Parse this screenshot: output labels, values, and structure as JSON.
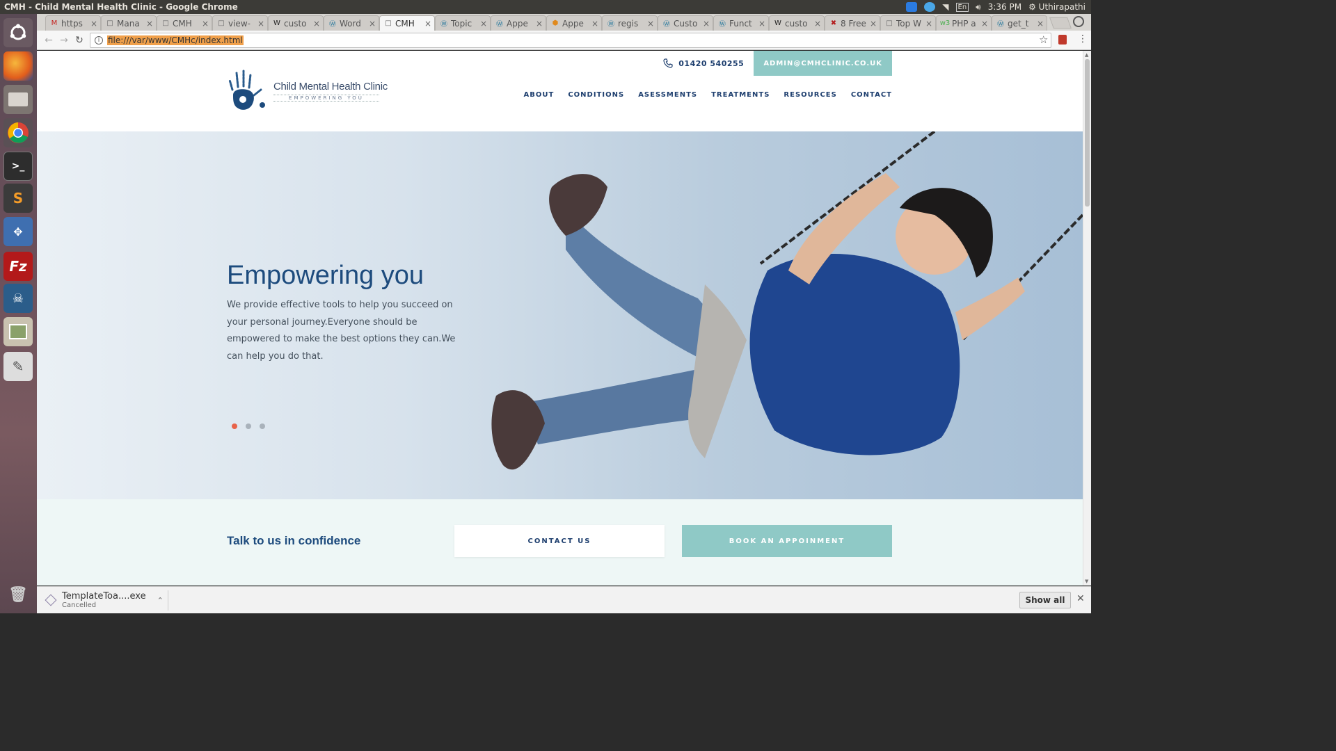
{
  "os": {
    "window_title": "CMH - Child Mental Health Clinic - Google Chrome",
    "tray": {
      "clock": "3:36 PM",
      "user": "Uthirapathi",
      "keyboard": "En"
    }
  },
  "launcher": {
    "icons": [
      "ubuntu-dash-icon",
      "firefox-icon",
      "files-icon",
      "chrome-icon",
      "terminal-icon",
      "sublime-text-icon",
      "network-icon",
      "filezilla-icon",
      "mysql-workbench-icon",
      "image-viewer-icon",
      "text-editor-icon",
      "trash-icon"
    ]
  },
  "browser": {
    "tabs": [
      {
        "label": "https",
        "fav": "M"
      },
      {
        "label": "Mana",
        "fav": "page"
      },
      {
        "label": "CMH",
        "fav": "page"
      },
      {
        "label": "view-",
        "fav": "page"
      },
      {
        "label": "custo",
        "fav": "W"
      },
      {
        "label": "Word",
        "fav": "wp"
      },
      {
        "label": "CMH",
        "fav": "page",
        "active": true
      },
      {
        "label": "Topic",
        "fav": "wp"
      },
      {
        "label": "Appe",
        "fav": "wp"
      },
      {
        "label": "Appe",
        "fav": "ext"
      },
      {
        "label": "regis",
        "fav": "wp"
      },
      {
        "label": "Custo",
        "fav": "wp"
      },
      {
        "label": "Funct",
        "fav": "wp"
      },
      {
        "label": "custo",
        "fav": "W"
      },
      {
        "label": "8 Free",
        "fav": "v"
      },
      {
        "label": "Top W",
        "fav": "page"
      },
      {
        "label": "PHP a",
        "fav": "w3"
      },
      {
        "label": "get_t",
        "fav": "wp"
      }
    ],
    "url": "file:///var/www/CMHc/index.html"
  },
  "site": {
    "phone": "01420 540255",
    "email": "ADMIN@CMHCLINIC.CO.UK",
    "logo_name": "Child Mental Health Clinic",
    "logo_tagline": "EMPOWERING YOU",
    "nav": [
      "ABOUT",
      "CONDITIONS",
      "ASESSMENTS",
      "TREATMENTS",
      "RESOURCES",
      "CONTACT"
    ],
    "hero": {
      "title": "Empowering you",
      "text": "We provide effective tools to help you succeed on your personal journey.Everyone should be empowered to make the best options they can.We can help you do that.",
      "slides_total": 3,
      "slide_active": 1
    },
    "cta": {
      "title": "Talk to us in confidence",
      "contact_label": "CONTACT US",
      "book_label": "BOOK AN APPOINMENT"
    },
    "colors": {
      "navy": "#1d3e6e",
      "teal": "#8fc9c6",
      "accent": "#e8634a"
    }
  },
  "downloads": {
    "filename": "TemplateToa....exe",
    "status": "Cancelled",
    "show_all_label": "Show all"
  }
}
